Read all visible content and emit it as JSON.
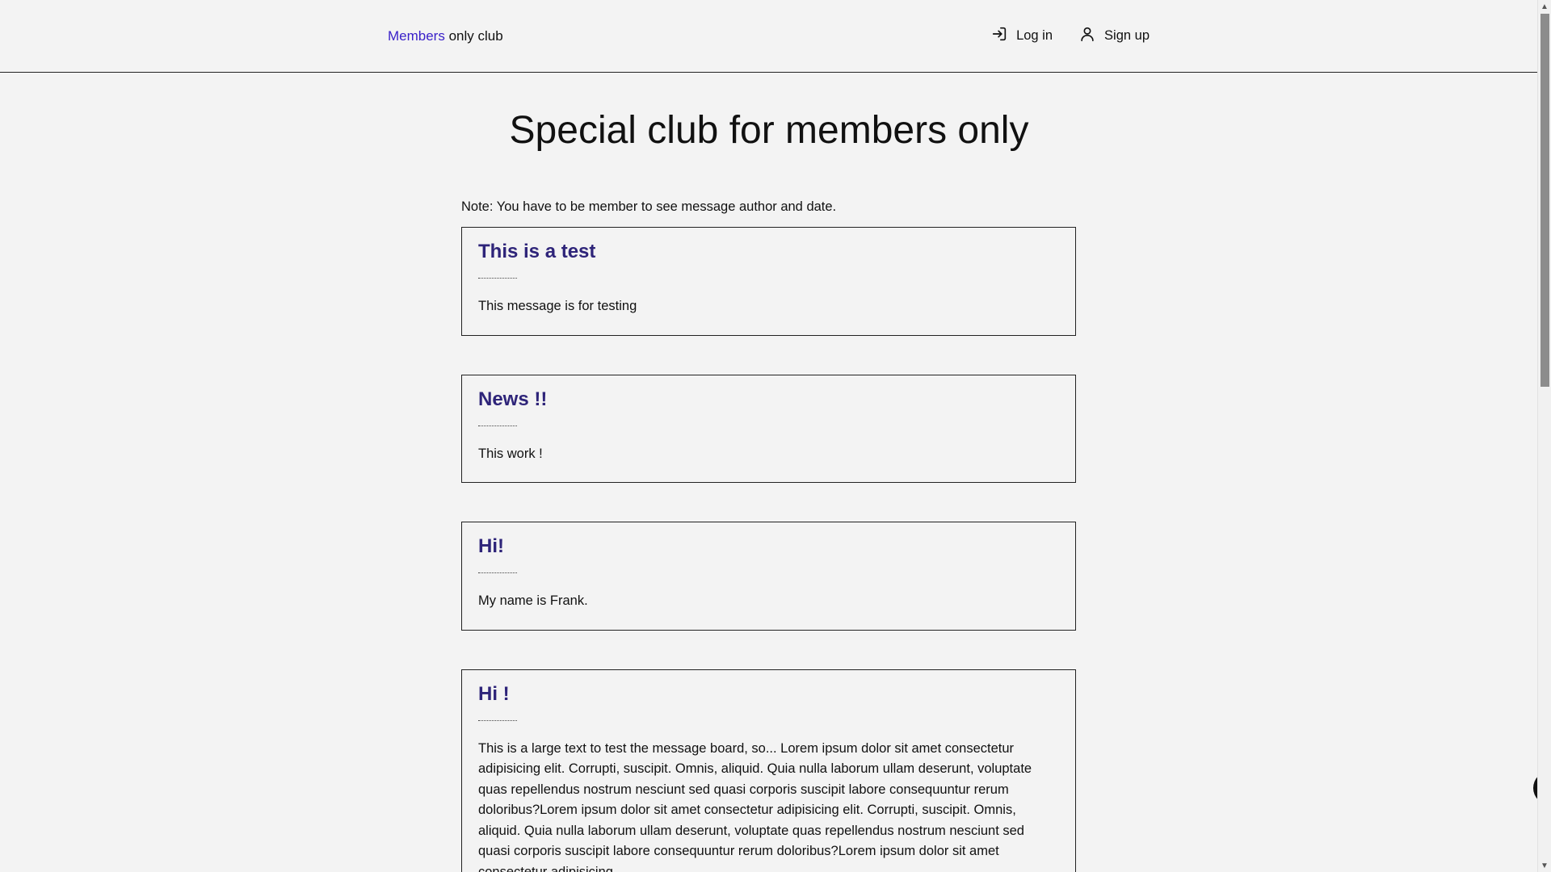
{
  "header": {
    "brand_accent": "Members",
    "brand_rest": " only club",
    "login_label": "Log in",
    "signup_label": "Sign up"
  },
  "main": {
    "title": "Special club for members only",
    "note": "Note: You have to be member to see message author and date."
  },
  "messages": [
    {
      "title": "This is a test",
      "body": "This message is for testing"
    },
    {
      "title": "News !!",
      "body": "This work !"
    },
    {
      "title": "Hi!",
      "body": "My name is Frank."
    },
    {
      "title": "Hi !",
      "body": "This is a large text to test the message board, so... Lorem ipsum dolor sit amet consectetur adipisicing elit. Corrupti, suscipit. Omnis, aliquid. Quia nulla laborum ullam deserunt, voluptate quas repellendus nostrum nesciunt sed quasi corporis suscipit labore consequuntur rerum doloribus?Lorem ipsum dolor sit amet consectetur adipisicing elit. Corrupti, suscipit. Omnis, aliquid. Quia nulla laborum ullam deserunt, voluptate quas repellendus nostrum nesciunt sed quasi corporis suscipit labore consequuntur rerum doloribus?Lorem ipsum dolor sit amet consectetur adipisicing"
    }
  ],
  "colors": {
    "accent": "#3a21c9",
    "card_title": "#2e2479",
    "background": "#f3f3f3"
  },
  "icons": {
    "login": "login-icon",
    "signup": "user-icon",
    "widget": "chevron-left-icon"
  }
}
